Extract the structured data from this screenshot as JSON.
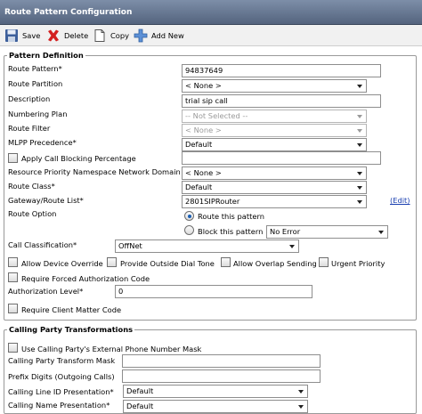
{
  "window": {
    "title": "Route Pattern Configuration"
  },
  "toolbar": {
    "save_label": "Save",
    "delete_label": "Delete",
    "copy_label": "Copy",
    "add_new_label": "Add New"
  },
  "pattern_definition": {
    "legend": "Pattern Definition",
    "route_pattern_label": "Route Pattern",
    "route_pattern_value": "94837649",
    "route_partition_label": "Route Partition",
    "route_partition_value": "< None >",
    "description_label": "Description",
    "description_value": "trial sip call",
    "numbering_plan_label": "Numbering Plan",
    "numbering_plan_value": "-- Not Selected --",
    "route_filter_label": "Route Filter",
    "route_filter_value": "< None >",
    "mlpp_label": "MLPP Precedence",
    "mlpp_value": "Default",
    "apply_blocking_label": "Apply Call Blocking Percentage",
    "apply_blocking_value": "",
    "resource_priority_label": "Resource Priority Namespace Network Domain",
    "resource_priority_value": "< None >",
    "route_class_label": "Route Class",
    "route_class_value": "Default",
    "gateway_label": "Gateway/Route List",
    "gateway_value": "2801SIPRouter",
    "edit_link": "(Edit)",
    "route_option_label": "Route Option",
    "route_this_pattern_label": "Route this pattern",
    "block_this_pattern_label": "Block this pattern",
    "block_reason_value": "No Error",
    "call_classification_label": "Call Classification",
    "call_classification_value": "OffNet",
    "allow_device_override_label": "Allow Device Override",
    "provide_outside_dial_tone_label": "Provide Outside Dial Tone",
    "allow_overlap_sending_label": "Allow Overlap Sending",
    "urgent_priority_label": "Urgent Priority",
    "require_fac_label": "Require Forced Authorization Code",
    "authorization_level_label": "Authorization Level",
    "authorization_level_value": "0",
    "require_cmc_label": "Require Client Matter Code",
    "required_marker": "*"
  },
  "calling_party": {
    "legend": "Calling Party Transformations",
    "use_external_mask_label": "Use Calling Party's External Phone Number Mask",
    "transform_mask_label": "Calling Party Transform Mask",
    "transform_mask_value": "",
    "prefix_digits_label": "Prefix Digits (Outgoing Calls)",
    "prefix_digits_value": "",
    "line_id_presentation_label": "Calling Line ID Presentation",
    "line_id_presentation_value": "Default",
    "name_presentation_label": "Calling Name Presentation",
    "name_presentation_value": "Default"
  }
}
